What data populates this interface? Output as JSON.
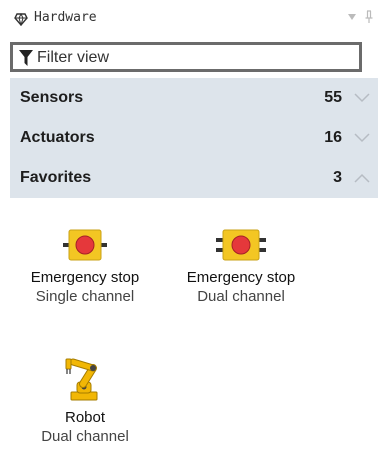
{
  "panel": {
    "title": "Hardware",
    "icon": "hardware-icon",
    "dropdown_icon": "chevron-down-icon",
    "pin_icon": "pin-icon"
  },
  "filter": {
    "placeholder": "Filter view",
    "value": "",
    "icon": "funnel-icon"
  },
  "categories": [
    {
      "label": "Sensors",
      "count": "55",
      "expanded": false,
      "icon": "chevron-down-icon"
    },
    {
      "label": "Actuators",
      "count": "16",
      "expanded": false,
      "icon": "chevron-down-icon"
    },
    {
      "label": "Favorites",
      "count": "3",
      "expanded": true,
      "icon": "chevron-up-icon"
    }
  ],
  "favorites": [
    {
      "name": "Emergency stop",
      "sub": "Single channel",
      "icon": "emergency-stop-single-icon"
    },
    {
      "name": "Emergency stop",
      "sub": "Dual channel",
      "icon": "emergency-stop-dual-icon"
    },
    {
      "name": "Robot",
      "sub": "Dual channel",
      "icon": "robot-arm-icon"
    }
  ],
  "colors": {
    "category_bg": "#dde4eb",
    "estop_red": "#e5383b",
    "estop_yellow": "#f3c623",
    "robot_yellow": "#f2b705",
    "filter_border": "#6b6b6b"
  }
}
